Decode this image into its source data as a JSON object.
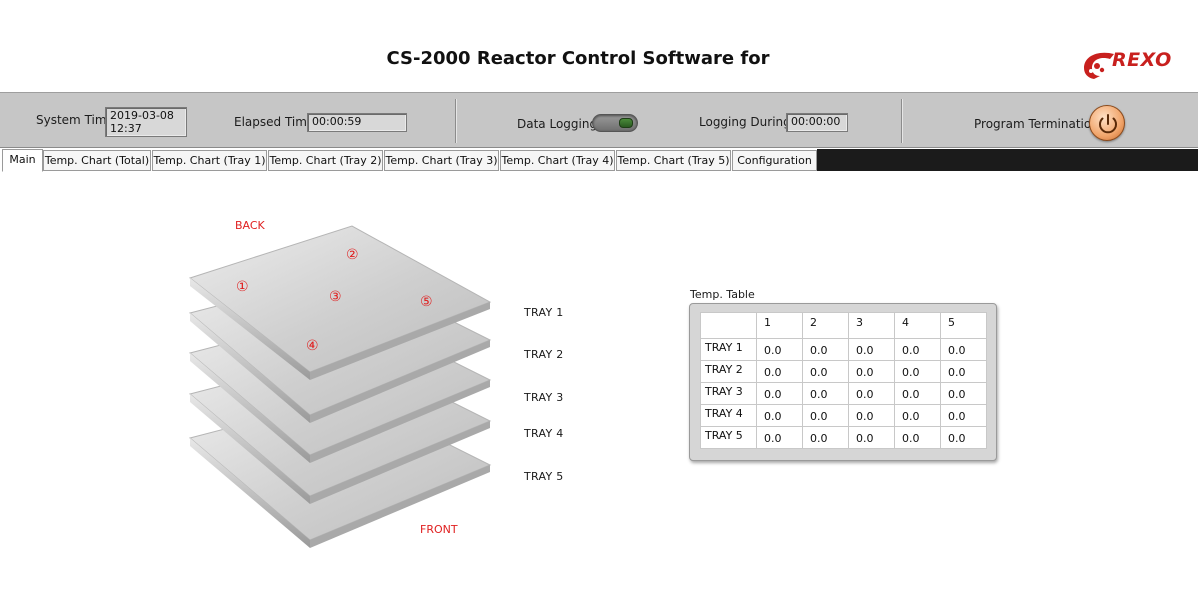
{
  "header": {
    "title": "CS-2000 Reactor Control Software for",
    "logo_text": "REXO",
    "logo_color": "#c8201e"
  },
  "toolbar": {
    "system_time_label": "System Time",
    "system_time_line1": "2019-03-08",
    "system_time_line2": "12:37",
    "elapsed_time_label": "Elapsed Time",
    "elapsed_time_value": "00:00:59",
    "data_logging_label": "Data Logging",
    "data_logging_on": true,
    "logging_during_label": "Logging During...",
    "logging_during_value": "00:00:00",
    "program_termination_label": "Program Termination",
    "power_icon": "power-icon"
  },
  "tabs": [
    {
      "label": "Main",
      "active": true
    },
    {
      "label": "Temp. Chart (Total)",
      "active": false
    },
    {
      "label": "Temp. Chart (Tray 1)",
      "active": false
    },
    {
      "label": "Temp. Chart (Tray 2)",
      "active": false
    },
    {
      "label": "Temp. Chart (Tray 3)",
      "active": false
    },
    {
      "label": "Temp. Chart (Tray 4)",
      "active": false
    },
    {
      "label": "Temp. Chart (Tray 5)",
      "active": false
    },
    {
      "label": "Configuration",
      "active": false
    }
  ],
  "diagram": {
    "back_label": "BACK",
    "front_label": "FRONT",
    "positions": [
      "①",
      "②",
      "③",
      "④",
      "⑤"
    ],
    "tray_labels": [
      "TRAY 1",
      "TRAY 2",
      "TRAY 3",
      "TRAY 4",
      "TRAY 5"
    ]
  },
  "temp_table": {
    "caption": "Temp. Table",
    "columns": [
      "1",
      "2",
      "3",
      "4",
      "5"
    ],
    "rows": [
      {
        "label": "TRAY 1",
        "values": [
          "0.0",
          "0.0",
          "0.0",
          "0.0",
          "0.0"
        ]
      },
      {
        "label": "TRAY 2",
        "values": [
          "0.0",
          "0.0",
          "0.0",
          "0.0",
          "0.0"
        ]
      },
      {
        "label": "TRAY 3",
        "values": [
          "0.0",
          "0.0",
          "0.0",
          "0.0",
          "0.0"
        ]
      },
      {
        "label": "TRAY 4",
        "values": [
          "0.0",
          "0.0",
          "0.0",
          "0.0",
          "0.0"
        ]
      },
      {
        "label": "TRAY 5",
        "values": [
          "0.0",
          "0.0",
          "0.0",
          "0.0",
          "0.0"
        ]
      }
    ]
  }
}
